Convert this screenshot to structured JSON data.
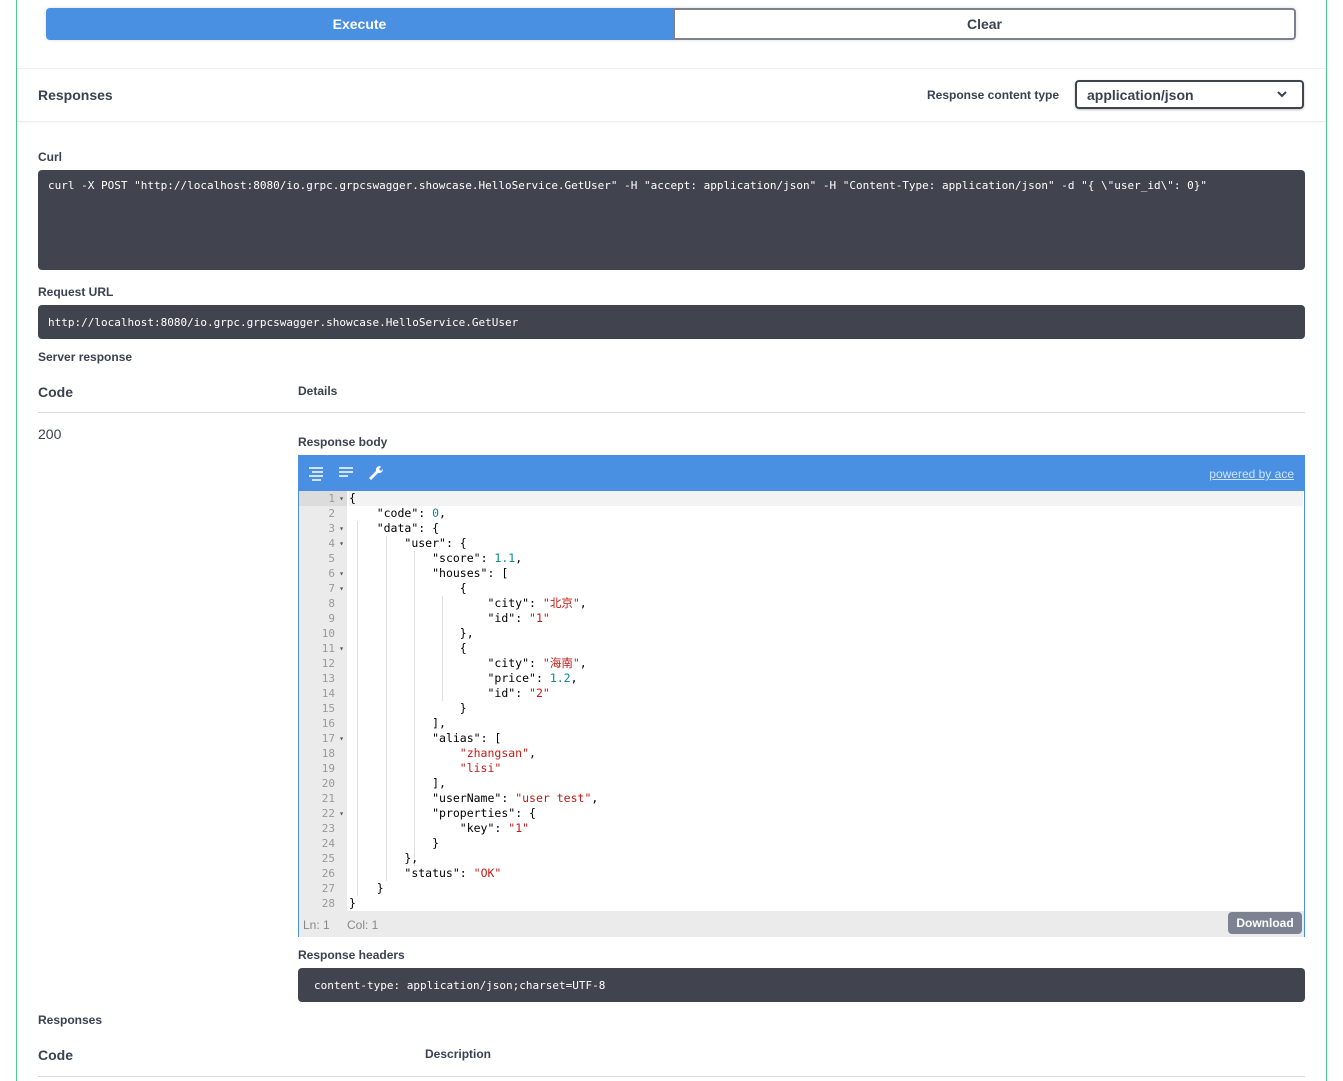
{
  "buttons": {
    "execute": "Execute",
    "clear": "Clear"
  },
  "responses_header": {
    "title": "Responses",
    "content_type_label": "Response content type",
    "content_type_value": "application/json"
  },
  "curl": {
    "label": "Curl",
    "command": "curl -X POST \"http://localhost:8080/io.grpc.grpcswagger.showcase.HelloService.GetUser\" -H \"accept: application/json\" -H \"Content-Type: application/json\" -d \"{ \\\"user_id\\\": 0}\""
  },
  "request_url": {
    "label": "Request URL",
    "value": "http://localhost:8080/io.grpc.grpcswagger.showcase.HelloService.GetUser"
  },
  "server_response": {
    "label": "Server response",
    "col_code": "Code",
    "col_details": "Details",
    "status_code": "200",
    "response_body_label": "Response body",
    "powered_by": "powered by ace",
    "status_ln": "Ln: 1",
    "status_col": "Col: 1",
    "download_label": "Download",
    "response_headers_label": "Response headers",
    "response_headers_value": "content-type: application/json;charset=UTF-8"
  },
  "body_lines": [
    {
      "n": "1",
      "fold": true,
      "text": "{"
    },
    {
      "n": "2",
      "fold": false,
      "text": "    \"code\": 0,"
    },
    {
      "n": "3",
      "fold": true,
      "text": "    \"data\": {"
    },
    {
      "n": "4",
      "fold": true,
      "text": "        \"user\": {"
    },
    {
      "n": "5",
      "fold": false,
      "text": "            \"score\": 1.1,"
    },
    {
      "n": "6",
      "fold": true,
      "text": "            \"houses\": ["
    },
    {
      "n": "7",
      "fold": true,
      "text": "                {"
    },
    {
      "n": "8",
      "fold": false,
      "text": "                    \"city\": \"北京\","
    },
    {
      "n": "9",
      "fold": false,
      "text": "                    \"id\": \"1\""
    },
    {
      "n": "10",
      "fold": false,
      "text": "                },"
    },
    {
      "n": "11",
      "fold": true,
      "text": "                {"
    },
    {
      "n": "12",
      "fold": false,
      "text": "                    \"city\": \"海南\","
    },
    {
      "n": "13",
      "fold": false,
      "text": "                    \"price\": 1.2,"
    },
    {
      "n": "14",
      "fold": false,
      "text": "                    \"id\": \"2\""
    },
    {
      "n": "15",
      "fold": false,
      "text": "                }"
    },
    {
      "n": "16",
      "fold": false,
      "text": "            ],"
    },
    {
      "n": "17",
      "fold": true,
      "text": "            \"alias\": ["
    },
    {
      "n": "18",
      "fold": false,
      "text": "                \"zhangsan\","
    },
    {
      "n": "19",
      "fold": false,
      "text": "                \"lisi\""
    },
    {
      "n": "20",
      "fold": false,
      "text": "            ],"
    },
    {
      "n": "21",
      "fold": false,
      "text": "            \"userName\": \"user test\","
    },
    {
      "n": "22",
      "fold": true,
      "text": "            \"properties\": {"
    },
    {
      "n": "23",
      "fold": false,
      "text": "                \"key\": \"1\""
    },
    {
      "n": "24",
      "fold": false,
      "text": "            }"
    },
    {
      "n": "25",
      "fold": false,
      "text": "        },"
    },
    {
      "n": "26",
      "fold": false,
      "text": "        \"status\": \"OK\""
    },
    {
      "n": "27",
      "fold": false,
      "text": "    }"
    },
    {
      "n": "28",
      "fold": false,
      "text": "}"
    }
  ],
  "bottom_responses": {
    "label": "Responses",
    "col_code": "Code",
    "col_description": "Description"
  },
  "colors": {
    "accent": "#4990e2",
    "border": "#49cc90",
    "code_bg": "#41444e"
  },
  "icons": [
    "wrap-lines-icon",
    "format-icon",
    "wrench-icon"
  ]
}
